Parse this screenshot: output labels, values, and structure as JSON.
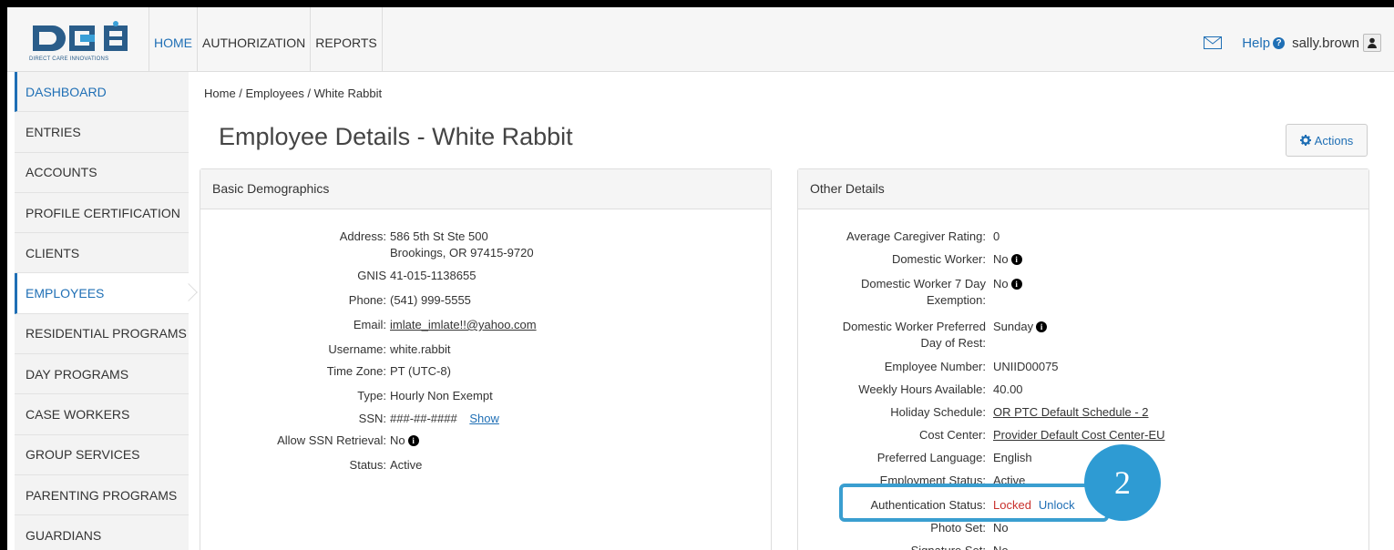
{
  "logo": {
    "tagline": "DIRECT CARE INNOVATIONS"
  },
  "topnav": {
    "items": [
      "HOME",
      "AUTHORIZATION",
      "REPORTS"
    ],
    "help_label": "Help",
    "username": "sally.brown"
  },
  "sidebar": {
    "items": [
      {
        "label": "DASHBOARD"
      },
      {
        "label": "ENTRIES"
      },
      {
        "label": "ACCOUNTS"
      },
      {
        "label": "PROFILE CERTIFICATION"
      },
      {
        "label": "CLIENTS"
      },
      {
        "label": "EMPLOYEES"
      },
      {
        "label": "RESIDENTIAL PROGRAMS"
      },
      {
        "label": "DAY PROGRAMS"
      },
      {
        "label": "CASE WORKERS"
      },
      {
        "label": "GROUP SERVICES"
      },
      {
        "label": "PARENTING PROGRAMS"
      },
      {
        "label": "GUARDIANS"
      }
    ]
  },
  "breadcrumb": "Home / Employees / White Rabbit",
  "page_title": "Employee Details - White Rabbit",
  "actions_label": "Actions",
  "basic": {
    "heading": "Basic Demographics",
    "address_label": "Address:",
    "address_line1": "586 5th St Ste 500",
    "address_line2": "Brookings, OR 97415-9720",
    "gnis_label": "GNIS",
    "gnis": "41-015-1138655",
    "phone_label": "Phone:",
    "phone": "(541) 999-5555",
    "email_label": "Email:",
    "email": "imlate_imlate!!@yahoo.com",
    "username_label": "Username:",
    "username": "white.rabbit",
    "timezone_label": "Time Zone:",
    "timezone": "PT (UTC-8)",
    "type_label": "Type:",
    "type": "Hourly Non Exempt",
    "ssn_label": "SSN:",
    "ssn": "###-##-####",
    "ssn_show": "Show",
    "allow_ssn_label": "Allow SSN Retrieval:",
    "allow_ssn": "No",
    "status_label": "Status:",
    "status": "Active"
  },
  "other": {
    "heading": "Other Details",
    "rating_label": "Average Caregiver Rating:",
    "rating": "0",
    "domestic_label": "Domestic Worker:",
    "domestic": "No",
    "dw7_label_1": "Domestic Worker 7 Day",
    "dw7_label_2": "Exemption:",
    "dw7": "No",
    "dwrest_label_1": "Domestic Worker Preferred",
    "dwrest_label_2": "Day of Rest:",
    "dwrest": "Sunday",
    "empnum_label": "Employee Number:",
    "empnum": "UNIID00075",
    "hours_label": "Weekly Hours Available:",
    "hours": "40.00",
    "holiday_label": "Holiday Schedule:",
    "holiday": "OR PTC Default Schedule - 2",
    "cost_label": "Cost Center:",
    "cost": "Provider Default Cost Center-EU",
    "lang_label": "Preferred Language:",
    "lang": "English",
    "empstatus_label": "Employment Status:",
    "empstatus": "Active",
    "auth_label": "Authentication Status:",
    "auth": "Locked",
    "unlock": "Unlock",
    "photo_label": "Photo Set:",
    "photo": "No",
    "sig_label": "Signature Set:",
    "sig": "No"
  },
  "step_badge": "2",
  "colors": {
    "accent": "#1f6fb5",
    "locked": "#c9302c",
    "callout": "#2e9bd3"
  }
}
